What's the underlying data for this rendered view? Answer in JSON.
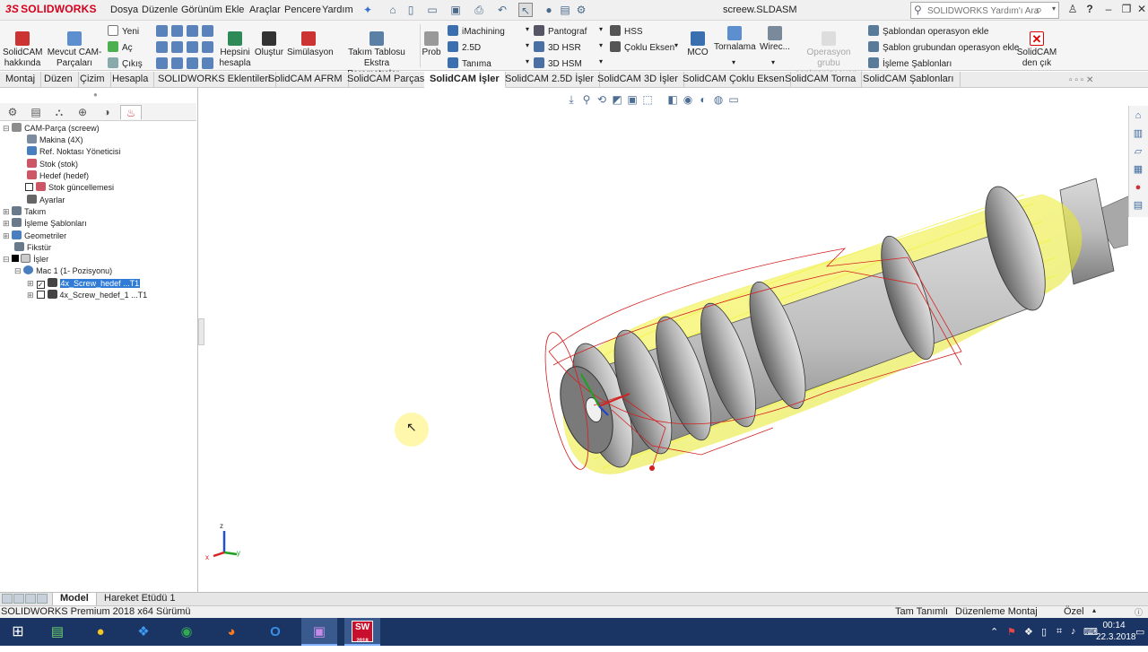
{
  "titlebar": {
    "app_name": "SOLIDWORKS",
    "menu": [
      "Dosya",
      "Düzenle",
      "Görünüm",
      "Ekle",
      "Araçlar",
      "Pencere",
      "Yardım"
    ],
    "document_title": "screew.SLDASM",
    "search_placeholder": "SOLIDWORKS Yardım'ı Ara",
    "help_label": "?"
  },
  "ribbon": {
    "about": "SolidCAM hakkında",
    "existing_parts": "Mevcut CAM-Parçaları",
    "file_new": "Yeni",
    "file_open": "Aç",
    "file_exit": "Çıkış",
    "calc_all": "Hepsini hesapla",
    "generate": "Oluştur",
    "simulation": "Simülasyon",
    "tool_table_extra": "Takım Tablosu Ekstra Parametreler...",
    "probe": "Prob",
    "imachining": "iMachining",
    "op_25d": "2.5D",
    "definition": "Tanıma",
    "pantograph": "Pantograf",
    "hsr_3d": "3D HSR",
    "hsm_3d": "3D HSM",
    "hss": "HSS",
    "multiaxis": "Çoklu Eksen",
    "mco": "MCO",
    "turning": "Tornalama",
    "wire": "Wirec...",
    "sync_ops": "Operasyon grubu senkronizasyonu",
    "add_from_template": "Şablondan operasyon ekle",
    "add_from_template_group": "Şablon grubundan operasyon ekle",
    "machining_templates": "İşleme Şablonları",
    "exit_solidcam": "SolidCAM den çık"
  },
  "tabs": [
    "Montaj",
    "Düzen",
    "Çizim",
    "Hesapla",
    "SOLIDWORKS Eklentileri",
    "SolidCAM AFRM",
    "SolidCAM Parçası",
    "SolidCAM İşler",
    "SolidCAM 2.5D İşler",
    "SolidCAM 3D İşler",
    "SolidCAM Çoklu Eksen",
    "SolidCAM Torna",
    "SolidCAM Şablonları"
  ],
  "active_tab": "SolidCAM İşler",
  "tree": {
    "root": "CAM-Parça (screew)",
    "machine": "Makina (4X)",
    "ref_manager": "Ref. Noktası Yöneticisi",
    "stock": "Stok (stok)",
    "target": "Hedef (hedef)",
    "stock_update": "Stok güncellemesi",
    "settings": "Ayarlar",
    "tool": "Takım",
    "templates": "İşleme Şablonları",
    "geometries": "Geometriler",
    "fixture": "Fikstür",
    "operations": "İşler",
    "setup": "Mac 1 (1- Pozisyonu)",
    "op1": "4x_Screw_hedef ...T1",
    "op2": "4x_Screw_hedef_1 ...T1"
  },
  "bottom_tabs": [
    "Model",
    "Hareket Etüdü 1"
  ],
  "status": {
    "version": "SOLIDWORKS Premium 2018 x64 Sürümü",
    "definition": "Tam Tanımlı",
    "mode": "Düzenleme Montaj",
    "units": "Özel"
  },
  "taskbar": {
    "time": "00:14",
    "date": "22.3.2018",
    "sw_badge": "SW",
    "sw_year": "2018"
  },
  "triad": {
    "z": "z",
    "x": "x",
    "y": "y"
  },
  "colors": {
    "toolpath": "#e8e820",
    "link_path": "#d42020",
    "accent": "#d6001c",
    "taskbar": "#1a3564"
  }
}
